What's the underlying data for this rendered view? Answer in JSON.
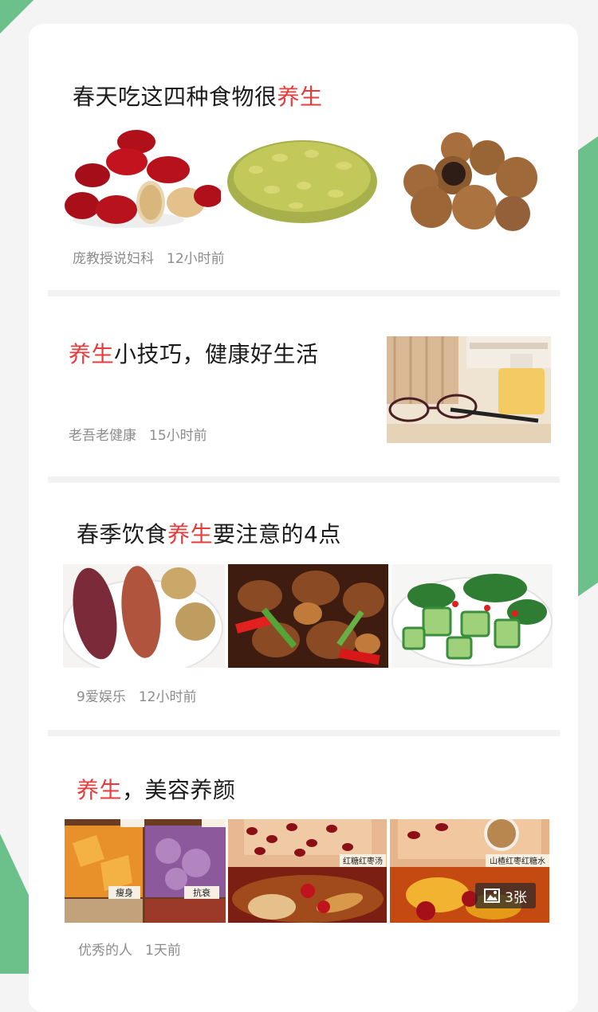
{
  "feed": {
    "articles": [
      {
        "title_parts": [
          "春天吃这四种食物很",
          "养生"
        ],
        "source": "庞教授说妇科",
        "time": "12小时前",
        "images": [
          "red-dates",
          "green-raisins",
          "longan"
        ]
      },
      {
        "title_parts": [
          "养生",
          "小技巧，健康好生活"
        ],
        "source": "老吾老健康",
        "time": "15小时前",
        "images": [
          "glasses-on-table"
        ]
      },
      {
        "title_parts": [
          "春季饮食",
          "养生",
          "要注意的4点"
        ],
        "source": "9爱娱乐",
        "time": "12小时前",
        "images": [
          "sweet-potato",
          "braised-chicken",
          "cucumber-salad"
        ]
      },
      {
        "title_parts": [
          "养生",
          "，美容养颜"
        ],
        "source": "优秀的人",
        "time": "1天前",
        "images": [
          "pumpkin-collage",
          "date-soup",
          "hawthorn-date-drink"
        ],
        "photo_count": "3张",
        "collage_labels": [
          "瘦身",
          "抗衰",
          "红糖红枣汤",
          "山楂红枣红糖水"
        ]
      }
    ]
  },
  "colors": {
    "highlight": "#e83b3b",
    "background_accent": "#6cc08a"
  }
}
